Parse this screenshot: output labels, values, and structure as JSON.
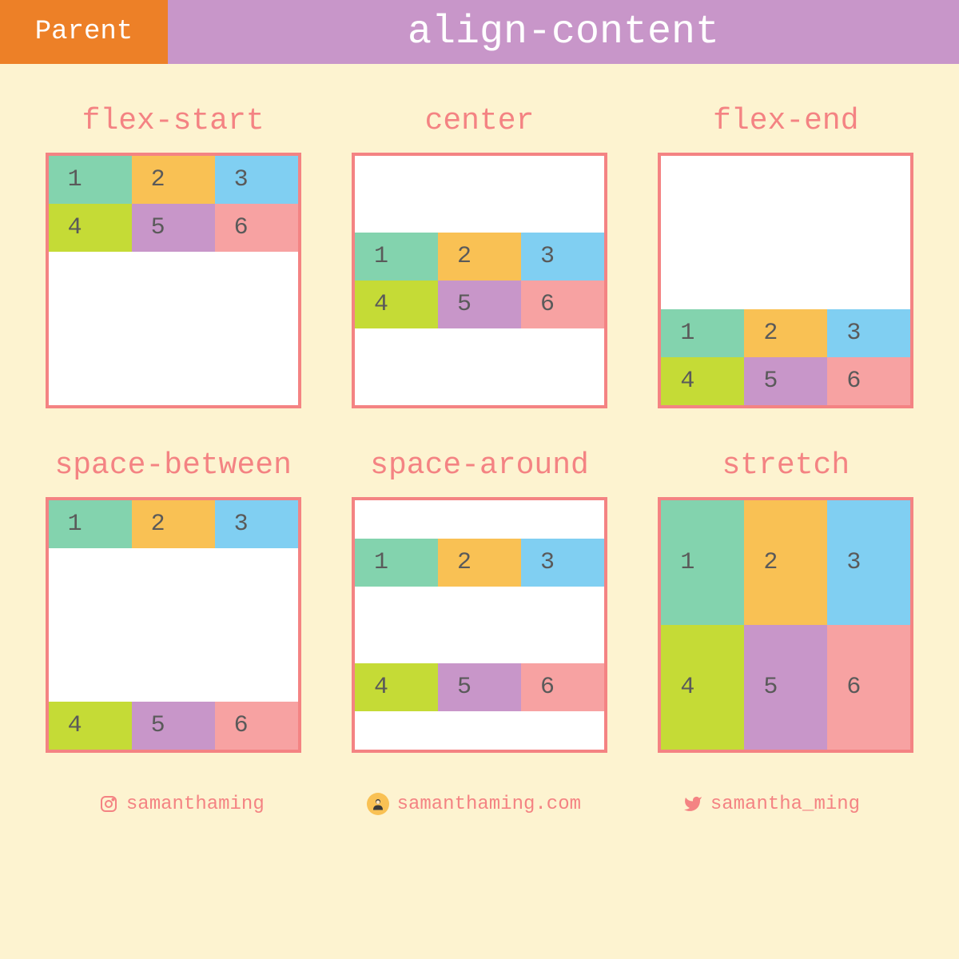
{
  "header": {
    "tag": "Parent",
    "title": "align-content"
  },
  "examples": [
    {
      "label": "flex-start",
      "mode": "flex-start"
    },
    {
      "label": "center",
      "mode": "center"
    },
    {
      "label": "flex-end",
      "mode": "flex-end"
    },
    {
      "label": "space-between",
      "mode": "space-between"
    },
    {
      "label": "space-around",
      "mode": "space-around"
    },
    {
      "label": "stretch",
      "mode": "stretch"
    }
  ],
  "items": [
    "1",
    "2",
    "3",
    "4",
    "5",
    "6"
  ],
  "item_colors": [
    "#83d3ae",
    "#f9c154",
    "#80cff2",
    "#c5db36",
    "#c896c9",
    "#f7a2a2"
  ],
  "footer": {
    "instagram": "samanthaming",
    "website": "samanthaming.com",
    "twitter": "samantha_ming"
  },
  "colors": {
    "background": "#fdf3d0",
    "header_tag": "#ed8027",
    "header_title": "#c896c9",
    "accent": "#f48383",
    "box_bg": "#ffffff"
  }
}
